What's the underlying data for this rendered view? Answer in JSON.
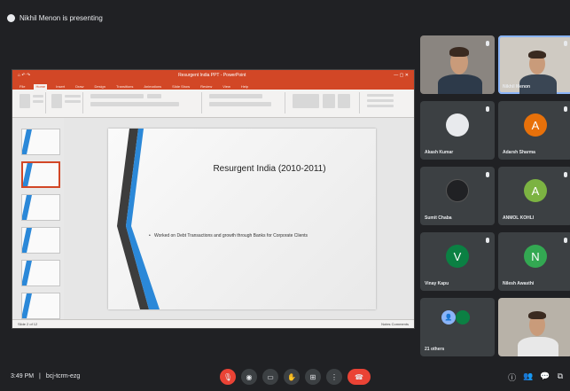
{
  "presenting": {
    "label": "Nikhil Menon is presenting"
  },
  "powerpoint": {
    "title": "Resurgent India PPT - PowerPoint",
    "tabs": [
      "File",
      "Home",
      "Insert",
      "Draw",
      "Design",
      "Transitions",
      "Animations",
      "Slide Show",
      "Review",
      "View",
      "Help"
    ],
    "slide_title": "Resurgent India (2010-2011)",
    "slide_bullet": "Worked on Debt Transactions and growth through Banks for Corporate Clients",
    "status_left": "Slide 2 of 12",
    "status_right": "Notes   Comments"
  },
  "participants": [
    {
      "name": "",
      "type": "video"
    },
    {
      "name": "Nikhil Menon",
      "type": "video",
      "pinned": true
    },
    {
      "name": "Akash Kumar",
      "type": "avatar",
      "initial": "",
      "color": "#e8eaed"
    },
    {
      "name": "Adarsh Sharma",
      "type": "avatar",
      "initial": "A",
      "color": "#e8710a"
    },
    {
      "name": "Sumit Chaba",
      "type": "avatar",
      "initial": "",
      "color": "#202124"
    },
    {
      "name": "ANMOL KOHLI",
      "type": "avatar",
      "initial": "A",
      "color": "#7cb342"
    },
    {
      "name": "Vinay Kapu",
      "type": "avatar",
      "initial": "V",
      "color": "#0b8043"
    },
    {
      "name": "Nilesh Awasthi",
      "type": "avatar",
      "initial": "N",
      "color": "#33a852"
    },
    {
      "name": "21 others",
      "type": "others"
    },
    {
      "name": "",
      "type": "video"
    }
  ],
  "footer": {
    "time": "3:49 PM",
    "meeting_code": "bcj-tcrm-ezg"
  },
  "colors": {
    "accent": "#8ab4f8",
    "end_call": "#ea4335",
    "ppt": "#d24726",
    "background": "#202124"
  }
}
